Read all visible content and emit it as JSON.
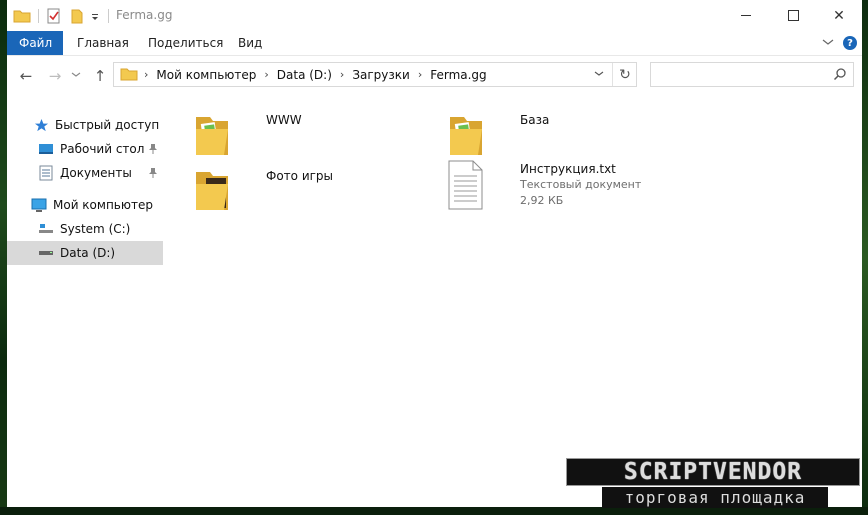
{
  "window": {
    "title": "Ferma.gg",
    "controls": {
      "minimize": "—",
      "maximize": "☐",
      "close": "✕"
    }
  },
  "ribbon": {
    "tabs": [
      {
        "label": "Файл",
        "active": true
      },
      {
        "label": "Главная"
      },
      {
        "label": "Поделиться"
      },
      {
        "label": "Вид"
      }
    ],
    "expand_glyph": "⌄",
    "help_glyph": "?"
  },
  "navigation": {
    "back": "←",
    "forward": "→",
    "recent": "⌄",
    "up": "↑",
    "breadcrumb": [
      "Мой компьютер",
      "Data (D:)",
      "Загрузки",
      "Ferma.gg"
    ],
    "separator": "›",
    "dropdown_glyph": "⌄",
    "refresh_glyph": "↻",
    "search_placeholder": ""
  },
  "nav_pane": {
    "items": [
      {
        "label": "Быстрый доступ",
        "icon": "star-icon"
      },
      {
        "label": "Рабочий стол",
        "icon": "desktop-icon",
        "pinned": true
      },
      {
        "label": "Документы",
        "icon": "documents-icon",
        "pinned": true
      },
      {
        "label": "Мой компьютер",
        "icon": "computer-icon"
      },
      {
        "label": "System (C:)",
        "icon": "system-drive-icon"
      },
      {
        "label": "Data (D:)",
        "icon": "drive-icon",
        "selected": true
      }
    ]
  },
  "content": {
    "items": [
      {
        "name": "WWW",
        "type": "folder"
      },
      {
        "name": "База",
        "type": "folder"
      },
      {
        "name": "Фото игры",
        "type": "folder"
      },
      {
        "name": "Инструкция.txt",
        "type": "text-file",
        "kind": "Текстовый документ",
        "size": "2,92 КБ"
      }
    ]
  },
  "watermark": {
    "top": "SCRIPTVENDOR",
    "bottom": "торговая площадка"
  },
  "colors": {
    "accent": "#1a66b8",
    "selection": "#d9d9d9",
    "folder": "#f3c94f",
    "folder_dark": "#d9a531"
  }
}
